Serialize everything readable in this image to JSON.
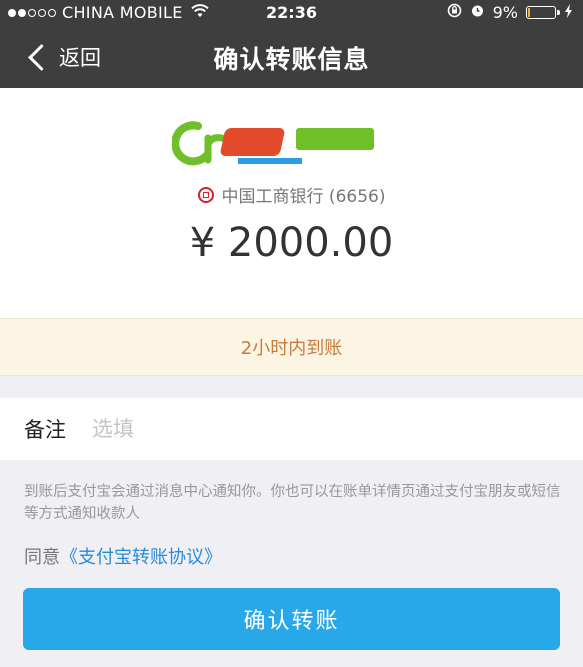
{
  "status_bar": {
    "carrier": "CHINA MOBILE",
    "time": "22:36",
    "battery_percent_label": "9%",
    "battery_level": 0.09
  },
  "nav": {
    "back_label": "返回",
    "title": "确认转账信息"
  },
  "recipient": {
    "bank_name": "中国工商银行 (6656)",
    "amount": "¥ 2000.00"
  },
  "notice": {
    "text": "2小时内到账"
  },
  "memo": {
    "label": "备注",
    "placeholder": "选填"
  },
  "info": {
    "text": "到账后支付宝会通过消息中心通知你。你也可以在账单详情页通过支付宝朋友或短信等方式通知收款人"
  },
  "agreement": {
    "prefix": "同意",
    "link": "《支付宝转账协议》"
  },
  "confirm": {
    "label": "确认转账"
  },
  "colors": {
    "nav_bg": "#3e3e3e",
    "notice_bg": "#fcf5e3",
    "notice_text": "#c57b3f",
    "primary": "#28a7e9",
    "link": "#2a8bd8"
  }
}
